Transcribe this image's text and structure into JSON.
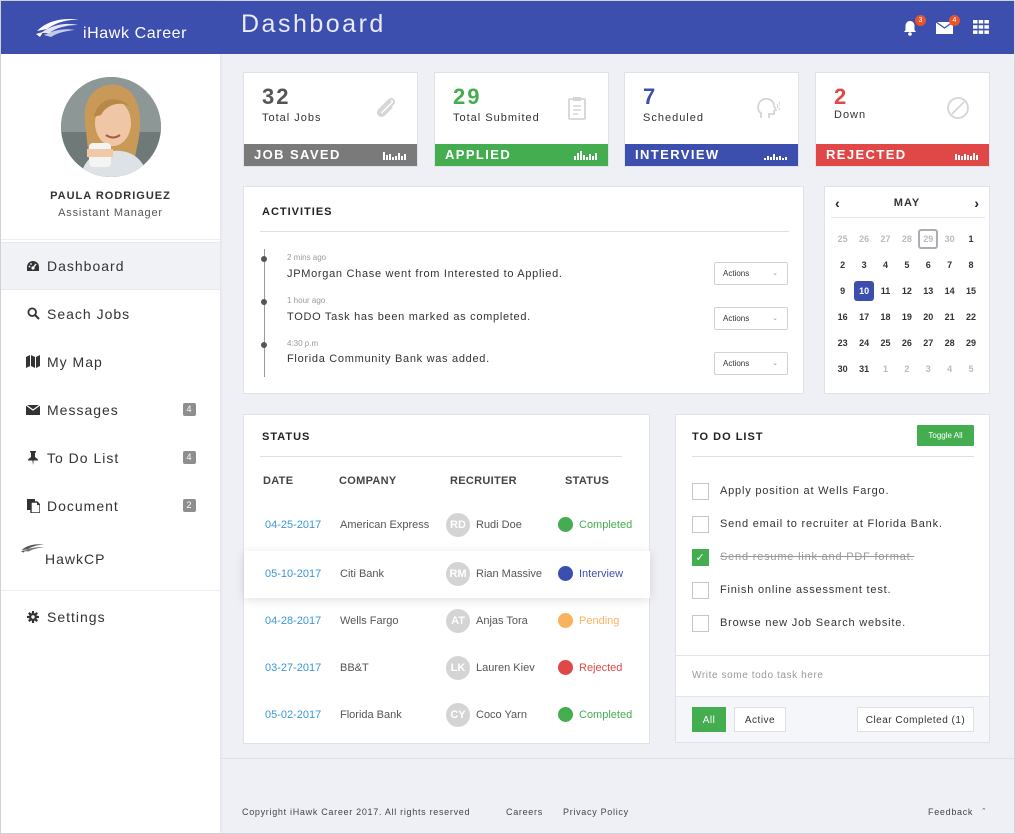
{
  "brand": {
    "name": "iHawk Career"
  },
  "header": {
    "title": "Dashboard",
    "notifications_count": "3",
    "messages_count": "4"
  },
  "profile": {
    "name": "PAULA RODRIGUEZ",
    "role": "Assistant Manager"
  },
  "sidebar": {
    "items": [
      {
        "label": "Dashboard",
        "icon": "dashboard-icon"
      },
      {
        "label": "Seach Jobs",
        "icon": "search-icon"
      },
      {
        "label": "My Map",
        "icon": "map-icon"
      },
      {
        "label": "Messages",
        "icon": "envelope-icon",
        "badge": "4"
      },
      {
        "label": "To Do List",
        "icon": "pin-icon",
        "badge": "4"
      },
      {
        "label": "Document",
        "icon": "document-icon",
        "badge": "2"
      },
      {
        "label": "HawkCP",
        "icon": "hawk-logo-icon"
      },
      {
        "label": "Settings",
        "icon": "gear-icon"
      }
    ]
  },
  "stats": [
    {
      "value": "32",
      "label": "Total Jobs",
      "bar": "JOB SAVED",
      "color": "#7a7a7a",
      "num_color": "#555555",
      "icon": "paperclip-icon"
    },
    {
      "value": "29",
      "label": "Total Submited",
      "bar": "APPLIED",
      "color": "#43ad4f",
      "num_color": "#43ad4f",
      "icon": "clipboard-icon"
    },
    {
      "value": "7",
      "label": "Scheduled",
      "bar": "INTERVIEW",
      "color": "#3d4fae",
      "num_color": "#3d4fae",
      "icon": "head-speaking-icon"
    },
    {
      "value": "2",
      "label": "Down",
      "bar": "REJECTED",
      "color": "#e04848",
      "num_color": "#e04848",
      "icon": "ban-icon"
    }
  ],
  "activities": {
    "title": "ACTIVITIES",
    "items": [
      {
        "time": "2 mins ago",
        "text": "JPMorgan Chase went from Interested to Applied.",
        "action": "Actions"
      },
      {
        "time": "1 hour ago",
        "text": "TODO Task has been marked as completed.",
        "action": "Actions"
      },
      {
        "time": "4:30 p.m",
        "text": "Florida Community Bank was added.",
        "action": "Actions"
      }
    ]
  },
  "calendar": {
    "month": "MAY",
    "weeks": [
      [
        "25",
        "26",
        "27",
        "28",
        "29",
        "30",
        "1"
      ],
      [
        "2",
        "3",
        "4",
        "5",
        "6",
        "7",
        "8"
      ],
      [
        "9",
        "10",
        "11",
        "12",
        "13",
        "14",
        "15"
      ],
      [
        "16",
        "17",
        "18",
        "19",
        "20",
        "21",
        "22"
      ],
      [
        "23",
        "24",
        "25",
        "26",
        "27",
        "28",
        "29"
      ],
      [
        "30",
        "31",
        "1",
        "2",
        "3",
        "4",
        "5"
      ]
    ],
    "today": "29",
    "selected": "10"
  },
  "status": {
    "title": "STATUS",
    "columns": [
      "DATE",
      "COMPANY",
      "RECRUITER",
      "STATUS"
    ],
    "rows": [
      {
        "date": "04-25-2017",
        "company": "American Express",
        "initials": "RD",
        "recruiter": "Rudi Doe",
        "status": "Completed",
        "color": "#43ad4f"
      },
      {
        "date": "05-10-2017",
        "company": "Citi Bank",
        "initials": "RM",
        "recruiter": "Rian Massive",
        "status": "Interview",
        "color": "#3d4fae"
      },
      {
        "date": "04-28-2017",
        "company": "Wells Fargo",
        "initials": "AT",
        "recruiter": "Anjas Tora",
        "status": "Pending",
        "color": "#f9b25e"
      },
      {
        "date": "03-27-2017",
        "company": "BB&T",
        "initials": "LK",
        "recruiter": "Lauren Kiev",
        "status": "Rejected",
        "color": "#e04848"
      },
      {
        "date": "05-02-2017",
        "company": "Florida Bank",
        "initials": "CY",
        "recruiter": "Coco Yarn",
        "status": "Completed",
        "color": "#43ad4f"
      }
    ]
  },
  "todo": {
    "title": "TO DO LIST",
    "toggle_label": "Toggle All",
    "items": [
      {
        "text": "Apply position at Wells Fargo.",
        "done": false
      },
      {
        "text": "Send email to recruiter at Florida Bank.",
        "done": false
      },
      {
        "text": "Send resume link and PDF format.",
        "done": true
      },
      {
        "text": "Finish online assessment test.",
        "done": false
      },
      {
        "text": "Browse new Job Search website.",
        "done": false
      }
    ],
    "placeholder": "Write some todo task here",
    "filter_all": "All",
    "filter_active": "Active",
    "clear_label": "Clear Completed (1)"
  },
  "footer": {
    "copyright": "Copyright  iHawk Career 2017. All rights reserved",
    "careers": "Careers",
    "privacy": "Privacy Policy",
    "feedback": "Feedback"
  }
}
